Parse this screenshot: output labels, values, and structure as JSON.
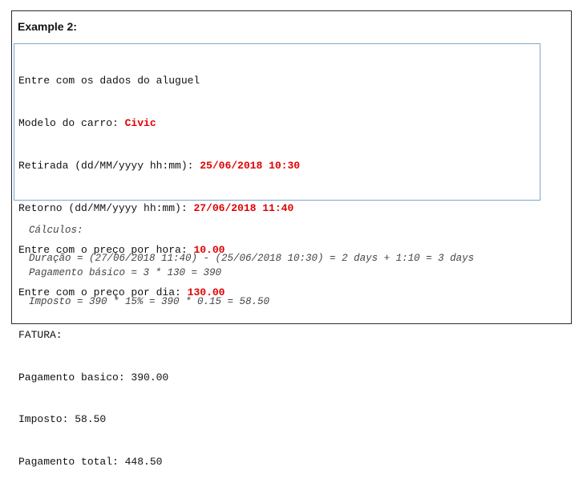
{
  "heading": "Example 2:",
  "console": {
    "line1": "Entre com os dados do aluguel",
    "modelo_label": "Modelo do carro: ",
    "modelo_value": "Civic",
    "retirada_label": "Retirada (dd/MM/yyyy hh:mm): ",
    "retirada_value": "25/06/2018 10:30",
    "retorno_label": "Retorno (dd/MM/yyyy hh:mm): ",
    "retorno_value": "27/06/2018 11:40",
    "hora_label": "Entre com o preço por hora: ",
    "hora_value": "10.00",
    "dia_label": "Entre com o preço por dia: ",
    "dia_value": "130.00",
    "fatura": "FATURA:",
    "basico": "Pagamento basico: 390.00",
    "imposto": "Imposto: 58.50",
    "total": "Pagamento total: 448.50"
  },
  "calculos": {
    "title": "Cálculos:",
    "duracao": "Duração = (27/06/2018 11:40) - (25/06/2018 10:30) = 2 days + 1:10 = 3 days",
    "pagamento": "Pagamento básico = 3 * 130 = 390",
    "imposto": "Imposto = 390 * 15% = 390 * 0.15 = 58.50"
  }
}
